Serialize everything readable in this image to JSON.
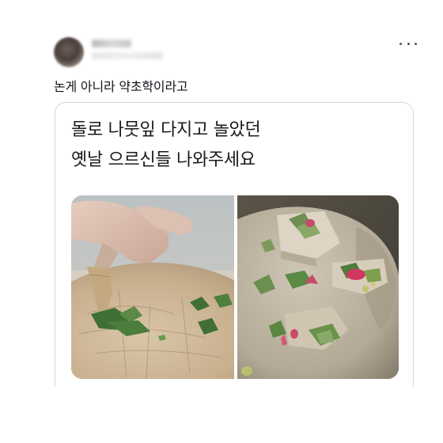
{
  "tweet": {
    "text": "논게 아니라 약초학이라고",
    "more_icon": "more-horizontal-icon"
  },
  "card": {
    "line1": "돌로 나뭇잎 다지고 놀았던",
    "line2": "옛날 으르신들 나와주세요"
  },
  "colors": {
    "text": "#0f1419",
    "border": "#cfd9de"
  }
}
